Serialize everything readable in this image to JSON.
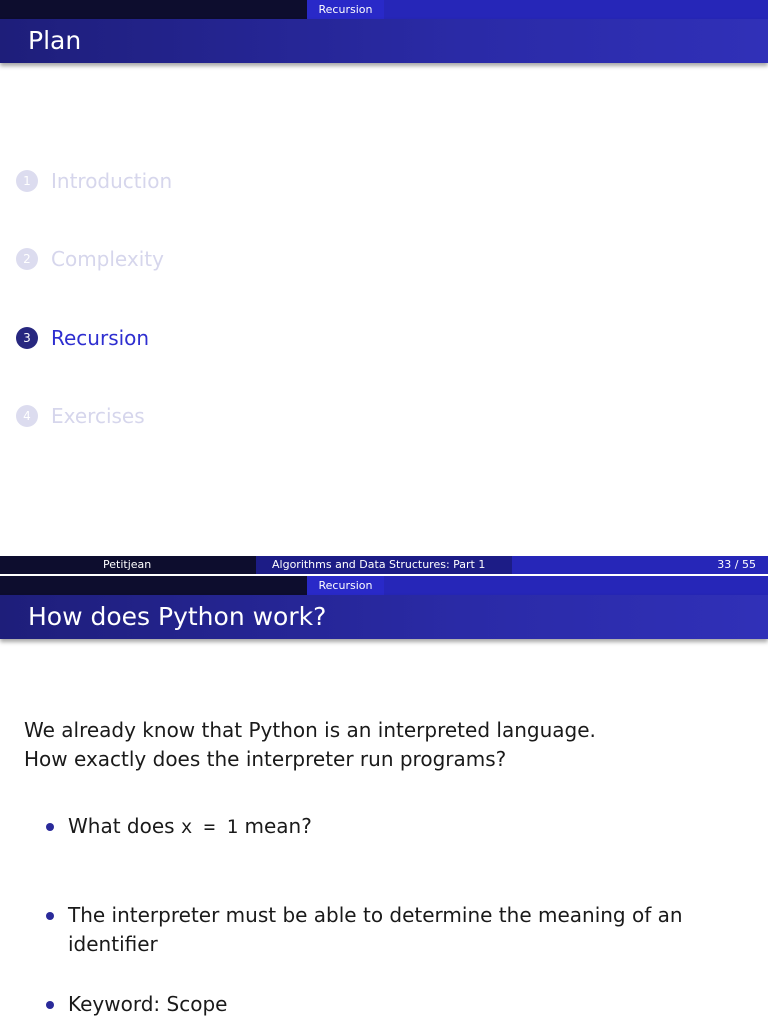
{
  "slide1": {
    "nav_section": "Recursion",
    "frame_title": "Plan",
    "toc": [
      {
        "num": "1",
        "label": "Introduction",
        "state": "dim"
      },
      {
        "num": "2",
        "label": "Complexity",
        "state": "dim"
      },
      {
        "num": "3",
        "label": "Recursion",
        "state": "active"
      },
      {
        "num": "4",
        "label": "Exercises",
        "state": "dim"
      }
    ],
    "footer": {
      "author": "Petitjean",
      "title": "Algorithms and Data Structures: Part 1",
      "page": "33 / 55"
    }
  },
  "slide2": {
    "nav_section": "Recursion",
    "frame_title": "How does Python work?",
    "intro_line1": "We already know that Python is an interpreted language.",
    "intro_line2": "How exactly does the interpreter run programs?",
    "bullet1_pre": "What does ",
    "bullet1_code": "x = 1",
    "bullet1_post": " mean?",
    "bullet2": "The interpreter must be able to determine the meaning of an identifier",
    "bullet3": "Keyword: Scope"
  },
  "colors": {
    "nav_dark": "#0d0d2e",
    "accent_blue": "#2929c8",
    "title_bar": "#2a2aa6",
    "active_toc": "#2e2ed0",
    "dim_toc": "#d6d6ec"
  }
}
